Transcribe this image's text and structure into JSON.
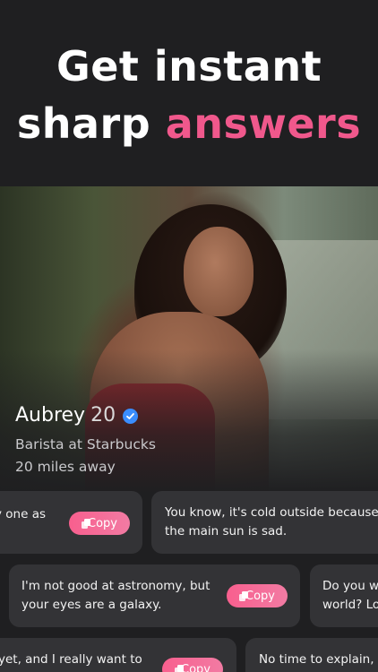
{
  "headline": {
    "line1": "Get instant",
    "line2_plain": "sharp",
    "line2_accent": "answers"
  },
  "profile": {
    "name": "Aubrey",
    "age": "20",
    "job": "Barista at Starbucks",
    "distance": "20 miles away"
  },
  "cards": {
    "row1": [
      {
        "text": "y one as",
        "copy_label": "Copy"
      },
      {
        "text_line1": "You know, it's cold outside because",
        "text_line2": "the main sun is sad."
      }
    ],
    "row2": [
      {
        "text_line1": "I'm not good at astronomy, but",
        "text_line2": "your eyes are a galaxy.",
        "copy_label": "Copy"
      },
      {
        "text_line1": "Do you w",
        "text_line2": "world? Lo"
      }
    ],
    "row3": [
      {
        "text": "yet, and I really want to",
        "copy_label": "Copy"
      },
      {
        "text": "No time to explain,"
      }
    ]
  },
  "colors": {
    "background": "#1f1f21",
    "accent": "#f0588c",
    "card": "#333336",
    "verified": "#3a8dff"
  }
}
